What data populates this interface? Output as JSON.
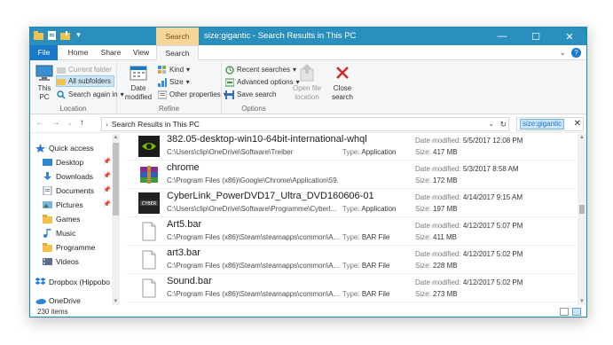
{
  "window": {
    "title": "size:gigantic - Search Results in This PC",
    "context_tab": "Search Tools",
    "controls": {
      "minimize": "—",
      "maximize": "☐",
      "close": "✕"
    }
  },
  "tabs": [
    "File",
    "Home",
    "Share",
    "View",
    "Search"
  ],
  "ribbon": {
    "location": {
      "this_pc": "This\nPC",
      "current_folder": "Current folder",
      "all_subfolders": "All subfolders",
      "search_again": "Search again in",
      "label": "Location"
    },
    "refine": {
      "date_modified": "Date\nmodified",
      "kind": "Kind",
      "size": "Size",
      "other_properties": "Other properties",
      "label": "Refine"
    },
    "options": {
      "recent_searches": "Recent searches",
      "advanced_options": "Advanced options",
      "save_search": "Save search",
      "open_file_location": "Open file\nlocation",
      "close_search": "Close\nsearch",
      "label": "Options"
    }
  },
  "address": {
    "path": "Search Results in This PC",
    "search_query": "size:gigantic"
  },
  "nav": {
    "quick_access": "Quick access",
    "items": [
      {
        "label": "Desktop",
        "pinned": true
      },
      {
        "label": "Downloads",
        "pinned": true
      },
      {
        "label": "Documents",
        "pinned": true
      },
      {
        "label": "Pictures",
        "pinned": true
      },
      {
        "label": "Games",
        "pinned": false
      },
      {
        "label": "Music",
        "pinned": false
      },
      {
        "label": "Programme",
        "pinned": false
      },
      {
        "label": "Videos",
        "pinned": false
      }
    ],
    "dropbox": "Dropbox (Hippobo",
    "onedrive": "OneDrive"
  },
  "labels": {
    "date_modified": "Date modified:",
    "size": "Size:",
    "type": "Type:"
  },
  "results": [
    {
      "name": "382.05-desktop-win10-64bit-international-whql",
      "path": "C:\\Users\\clip\\OneDrive\\Software\\Treiber",
      "type": "Application",
      "date": "5/5/2017 12:08 PM",
      "size": "417 MB",
      "icon": "nvidia"
    },
    {
      "name": "chrome",
      "path": "C:\\Program Files (x86)\\Google\\Chrome\\Application\\59.0.3071.36\\Installer",
      "type": "",
      "date": "5/3/2017 8:58 AM",
      "size": "172 MB",
      "icon": "winrar"
    },
    {
      "name": "CyberLink_PowerDVD17_Ultra_DVD160606-01",
      "path": "C:\\Users\\clip\\OneDrive\\Software\\Programme\\Cyberl...",
      "type": "Application",
      "date": "4/14/2017 9:15 AM",
      "size": "197 MB",
      "icon": "cyberlink"
    },
    {
      "name": "Art5.bar",
      "path": "C:\\Program Files (x86)\\Steam\\steamapps\\common\\A...",
      "type": "BAR File",
      "date": "4/12/2017 5:07 PM",
      "size": "411 MB",
      "icon": "file"
    },
    {
      "name": "art3.bar",
      "path": "C:\\Program Files (x86)\\Steam\\steamapps\\common\\A...",
      "type": "BAR File",
      "date": "4/12/2017 5:02 PM",
      "size": "228 MB",
      "icon": "file"
    },
    {
      "name": "Sound.bar",
      "path": "C:\\Program Files (x86)\\Steam\\steamapps\\common\\A...",
      "type": "BAR File",
      "date": "4/12/2017 5:02 PM",
      "size": "273 MB",
      "icon": "file"
    }
  ],
  "status": {
    "item_count": "230 items"
  },
  "colors": {
    "title_bar": "#2b8fbe",
    "file_tab": "#1979ca",
    "context_tab": "#f7d59a",
    "selection": "#cde6f7"
  }
}
